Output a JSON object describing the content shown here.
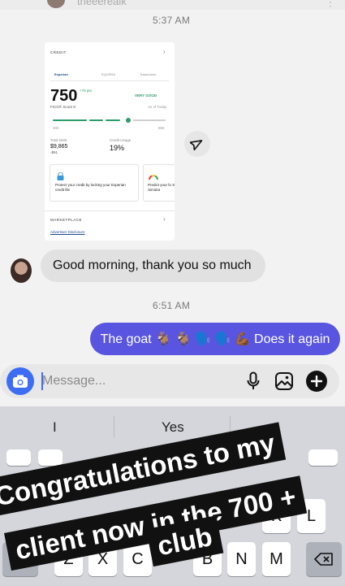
{
  "top": {
    "username": "theeerealk",
    "timestamp_1": "5:37 AM"
  },
  "shared_card": {
    "credit_label": "CREDIT",
    "bureaus": [
      "Experian",
      "EQUIFAX",
      "TransUnion"
    ],
    "score": "750",
    "score_change": "+79 pts",
    "rating": "VERY GOOD",
    "fico_label": "FICO® Score 8",
    "as_of": "As of Today",
    "range_min": "300",
    "range_max": "850",
    "total_debt_label": "Total Debt",
    "total_debt_value": "$9,865",
    "total_debt_change": "-$91",
    "credit_usage_label": "Credit Usage",
    "credit_usage_value": "19%",
    "lock_text": "Protect your credit by locking your Experian credit file",
    "predict_text": "Predict your fu Score Simulat",
    "marketplace_label": "MARKETPLACE",
    "advertiser_disclosure": "Advertiser Disclosure"
  },
  "messages": {
    "incoming_text": "Good morning, thank you so much",
    "timestamp_2": "6:51 AM",
    "outgoing_text": "The goat 🐐 🐐 🗣️ 🗣️ 💪🏾 Does it again"
  },
  "composer": {
    "placeholder": "Message..."
  },
  "keyboard": {
    "suggestions": [
      "I",
      "Yes",
      ""
    ],
    "row2_visible": [
      "K",
      "L"
    ],
    "row3_visible": [
      "Z",
      "X",
      "C",
      "B",
      "N",
      "M"
    ]
  },
  "overlay": {
    "line1": "Congratulations to my",
    "line2": "client now in the 700 +",
    "line3": "club"
  },
  "colors": {
    "accent": "#5a55e0",
    "camera": "#3d6df3",
    "score_green": "#2e9b6a"
  }
}
